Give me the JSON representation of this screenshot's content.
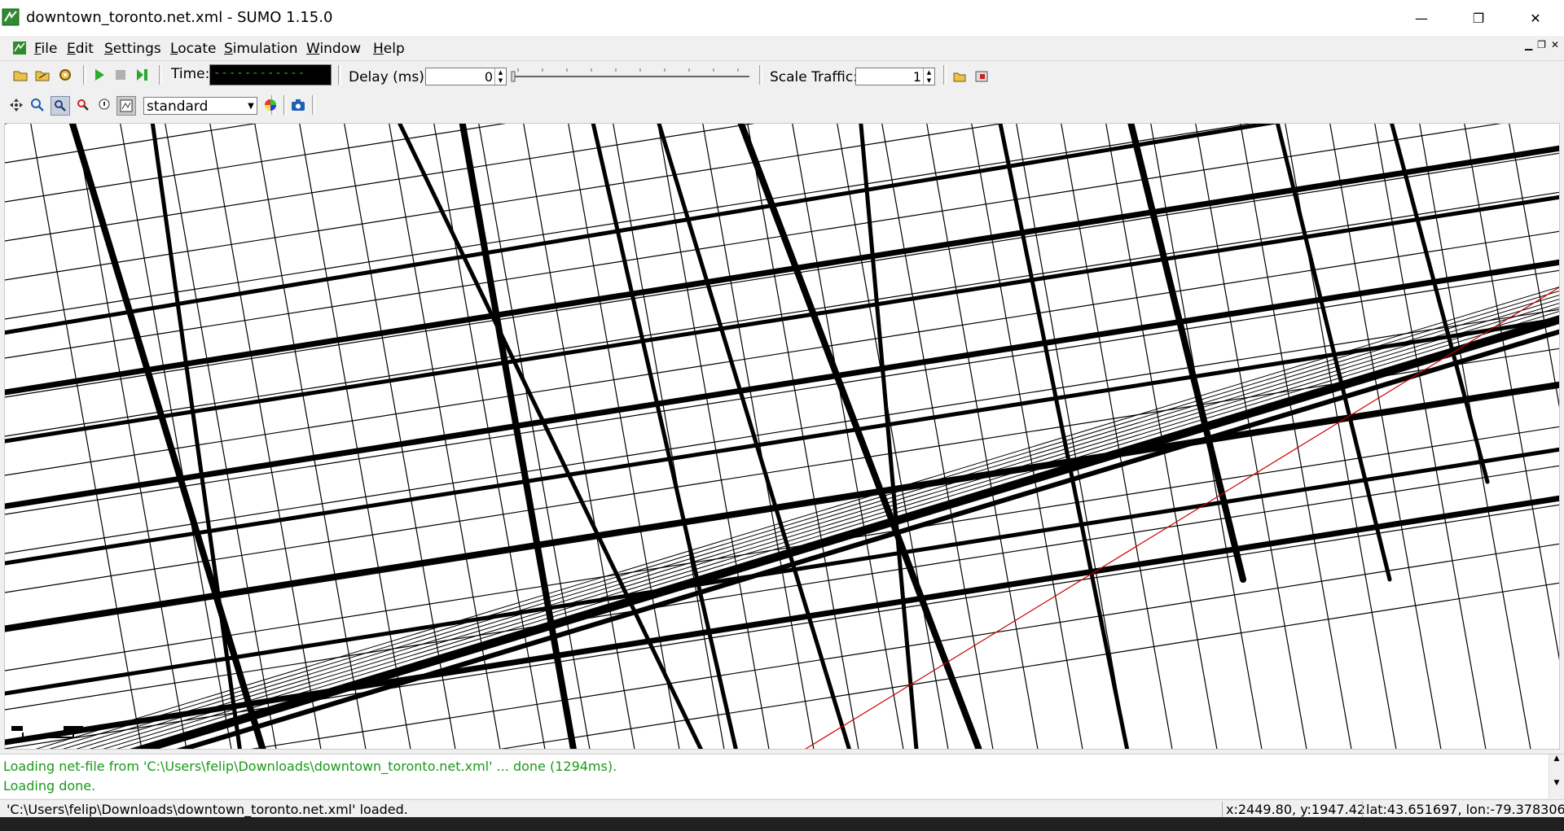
{
  "window": {
    "title": "downtown_toronto.net.xml - SUMO 1.15.0",
    "controls": {
      "minimize": "—",
      "restore": "❐",
      "close": "✕"
    }
  },
  "menu": {
    "items": [
      {
        "label": "File",
        "u": "F",
        "rest": "ile"
      },
      {
        "label": "Edit",
        "u": "E",
        "rest": "dit"
      },
      {
        "label": "Settings",
        "u": "S",
        "rest": "ettings"
      },
      {
        "label": "Locate",
        "u": "L",
        "rest": "ocate"
      },
      {
        "label": "Simulation",
        "u": "S",
        "rest": "imulation"
      },
      {
        "label": "Window",
        "u": "W",
        "rest": "indow"
      },
      {
        "label": "Help",
        "u": "H",
        "rest": "elp"
      }
    ]
  },
  "toolbar": {
    "time_label": "Time:",
    "time_value": "------------",
    "delay_label": "Delay (ms):",
    "delay_value": "0",
    "scale_label": "Scale Traffic:",
    "scale_value": "1"
  },
  "view_toolbar": {
    "scheme": "standard"
  },
  "log": {
    "lines": [
      "Loading net-file from 'C:\\Users\\felip\\Downloads\\downtown_toronto.net.xml' ... done (1294ms).",
      "Loading done."
    ]
  },
  "status": {
    "message": "'C:\\Users\\felip\\Downloads\\downtown_toronto.net.xml' loaded.",
    "xy": "x:2449.80, y:1947.42",
    "latlon": "lat:43.651697, lon:-79.378306"
  },
  "colors": {
    "log_text": "#1a9a1a",
    "time_text": "#00cc00",
    "road": "#000000",
    "boundary": "#cc0000"
  }
}
